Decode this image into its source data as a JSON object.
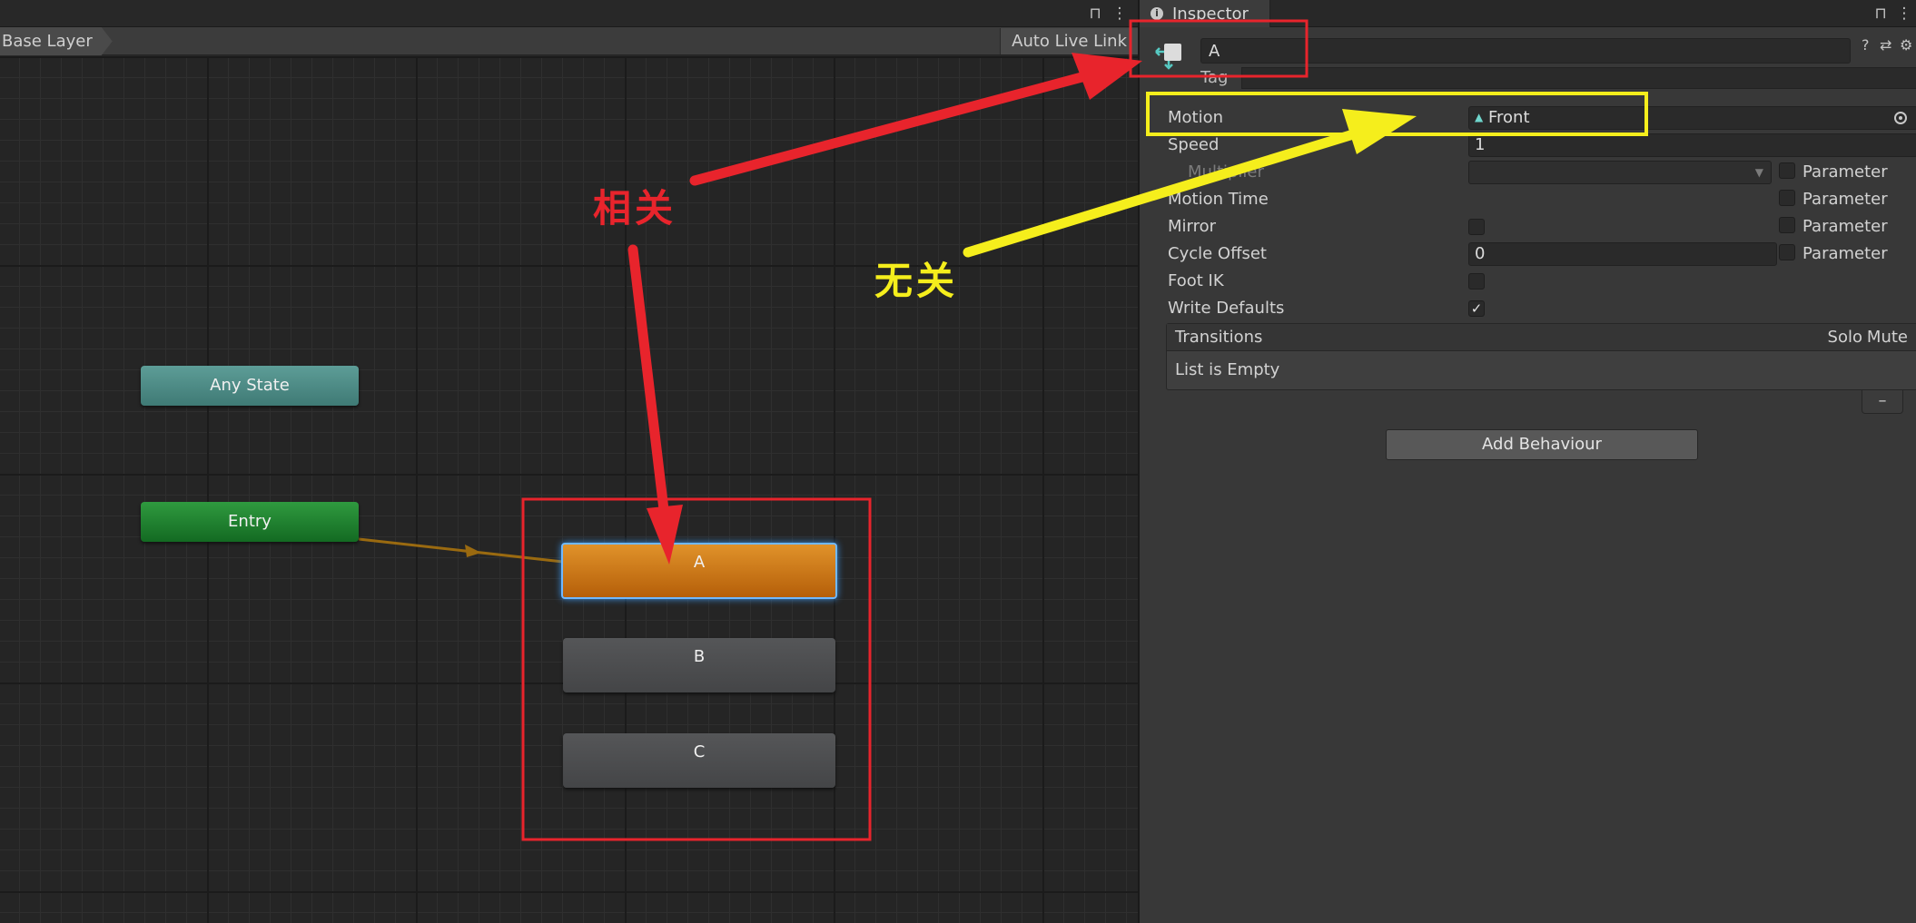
{
  "animator": {
    "breadcrumb": "Base Layer",
    "auto_live_link": "Auto Live Link",
    "nodes": {
      "any_state": "Any State",
      "entry": "Entry",
      "a": "A",
      "b": "B",
      "c": "C"
    },
    "colors": {
      "any_state": "#4f8e88",
      "entry": "#1f8231",
      "selected_state": "#d07a1a",
      "default_state": "#4d4e50",
      "entry_transition": "#9a6a10"
    }
  },
  "inspector": {
    "tab": "Inspector",
    "state_name": "A",
    "tag_label": "Tag",
    "rows": {
      "motion_label": "Motion",
      "motion_value": "Front",
      "speed_label": "Speed",
      "speed_value": "1",
      "multiplier_label": "Multiplier",
      "motion_time_label": "Motion Time",
      "mirror_label": "Mirror",
      "cycle_offset_label": "Cycle Offset",
      "cycle_offset_value": "0",
      "foot_ik_label": "Foot IK",
      "write_defaults_label": "Write Defaults"
    },
    "parameter_label": "Parameter",
    "write_defaults_checked": true,
    "transitions": {
      "header": "Transitions",
      "solo": "Solo",
      "mute": "Mute",
      "empty": "List is Empty"
    },
    "add_behaviour": "Add Behaviour"
  },
  "annotations": {
    "related": "相关",
    "unrelated": "无关",
    "red": "#e8242c",
    "yellow": "#f5ee1c"
  },
  "icons": [
    "lock-icon",
    "kebab-menu-icon",
    "info-icon",
    "state-icon",
    "help-icon",
    "preset-icon",
    "gear-icon",
    "object-picker-icon",
    "dropdown-arrow-icon",
    "checkmark-icon",
    "motion-clip-icon"
  ]
}
